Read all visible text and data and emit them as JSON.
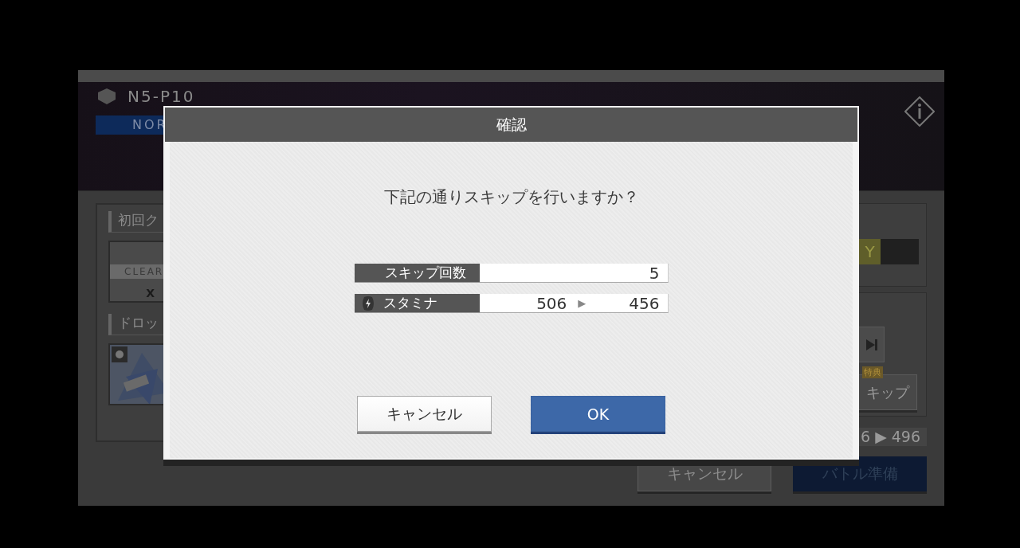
{
  "background": {
    "stage": {
      "code": "N5-P10",
      "difficulty": "NOR"
    },
    "first_clear": {
      "heading": "初回ク",
      "item_label": "CLEAR",
      "item_count": "X"
    },
    "drops": {
      "heading": "ドロッ"
    },
    "rank_tag": "Y",
    "bonus_tag": "特典",
    "skip_button": "キップ",
    "stamina_preview": "6 ▶ 496",
    "buttons": [
      {
        "label": "キャンセル",
        "kind": "secondary"
      },
      {
        "label": "バトル準備",
        "kind": "primary"
      }
    ]
  },
  "dialog": {
    "title": "確認",
    "message": "下記の通りスキップを行いますか？",
    "rows": [
      {
        "kind": "count",
        "label": "スキップ回数",
        "value": "5"
      },
      {
        "kind": "stamina",
        "label": "スタミナ",
        "from": "506",
        "arrow": "▶",
        "to": "456"
      }
    ],
    "buttons": [
      {
        "label": "キャンセル",
        "kind": "secondary"
      },
      {
        "label": "OK",
        "kind": "primary"
      }
    ]
  }
}
